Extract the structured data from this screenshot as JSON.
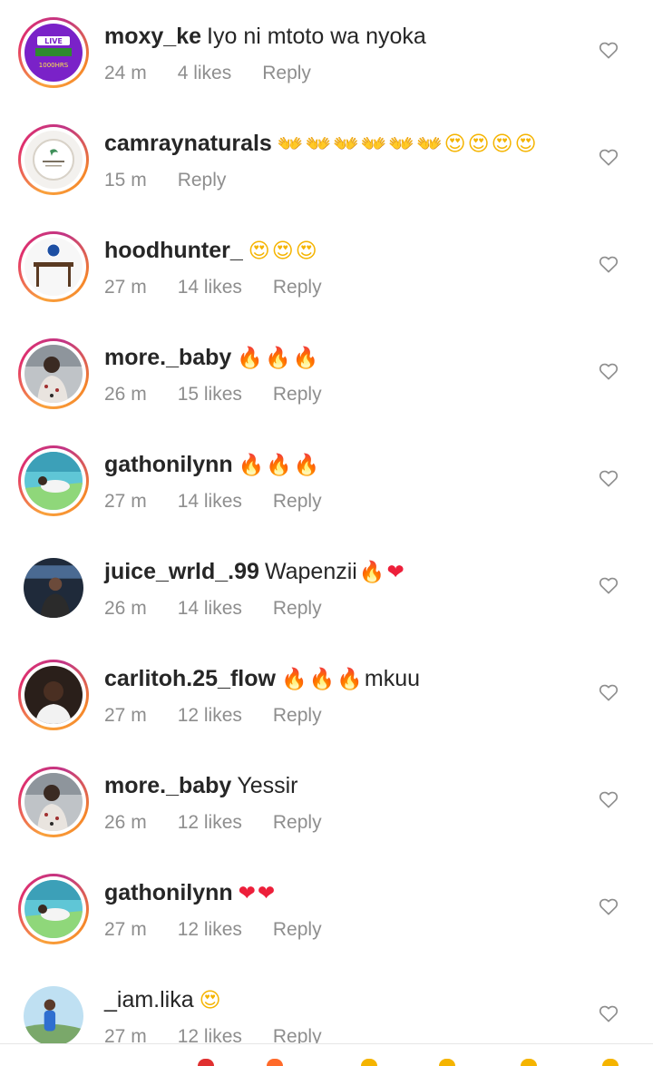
{
  "comments": [
    {
      "username": "moxy_ke",
      "text": "Iyo ni mtoto wa nyoka",
      "emoji": "",
      "emoji_after": "",
      "time": "24 m",
      "likes": "4 likes",
      "reply": "Reply",
      "avatar_text_top": "LIVE",
      "avatar_text_bottom": "1000HRS"
    },
    {
      "username": "camraynaturals",
      "text": "",
      "emoji": "👐👐👐👐👐👐😍😍😍😍",
      "emoji_after": "",
      "time": "15 m",
      "likes": "",
      "reply": "Reply"
    },
    {
      "username": "hoodhunter_",
      "text": "",
      "emoji": "😍😍😍",
      "emoji_after": "",
      "time": "27 m",
      "likes": "14 likes",
      "reply": "Reply"
    },
    {
      "username": "more._baby",
      "text": "",
      "emoji": "🔥🔥🔥",
      "emoji_after": "",
      "time": "26 m",
      "likes": "15 likes",
      "reply": "Reply"
    },
    {
      "username": "gathonilynn",
      "text": "",
      "emoji": "🔥🔥🔥",
      "emoji_after": "",
      "time": "27 m",
      "likes": "14 likes",
      "reply": "Reply"
    },
    {
      "username": "juice_wrld_.99",
      "text": "Wapenzii",
      "emoji": "🔥❤",
      "emoji_after": "",
      "time": "26 m",
      "likes": "14 likes",
      "reply": "Reply"
    },
    {
      "username": "carlitoh.25_flow",
      "text": "",
      "emoji": "🔥🔥🔥",
      "emoji_after": "mkuu",
      "time": "27 m",
      "likes": "12 likes",
      "reply": "Reply"
    },
    {
      "username": "more._baby",
      "text": "Yessir",
      "emoji": "",
      "emoji_after": "",
      "time": "26 m",
      "likes": "12 likes",
      "reply": "Reply"
    },
    {
      "username": "gathonilynn",
      "text": "",
      "emoji": "❤❤",
      "emoji_after": "",
      "time": "27 m",
      "likes": "12 likes",
      "reply": "Reply"
    },
    {
      "username": "_iam.lika",
      "text": "",
      "emoji": "😍",
      "emoji_after": "",
      "time": "27 m",
      "likes": "12 likes",
      "reply": "Reply"
    }
  ],
  "icons": {
    "like": "heart-outline-icon"
  },
  "colors": {
    "username": "#262626",
    "meta": "#8e8e8e",
    "story_ring": "#e1306c"
  }
}
